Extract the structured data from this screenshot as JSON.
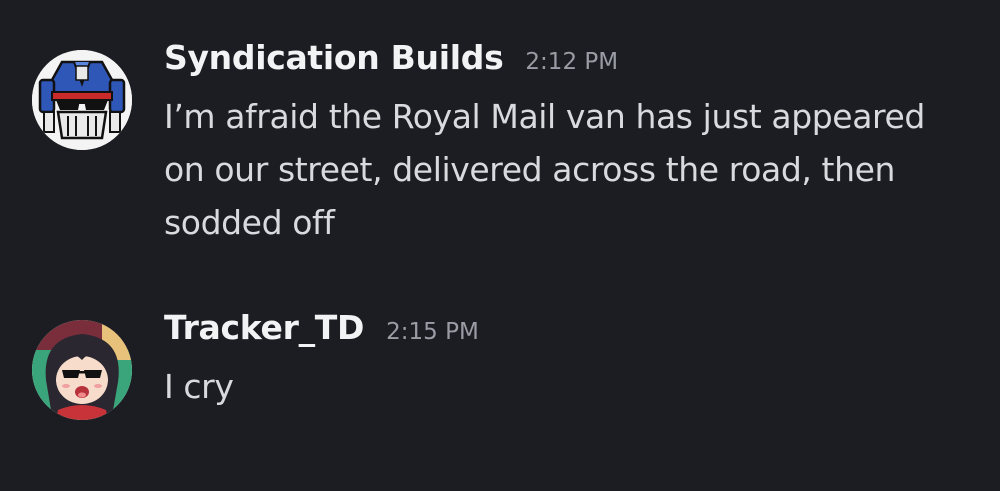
{
  "messages": [
    {
      "author": "Syndication Builds",
      "time": "2:12 PM",
      "text": "I’m afraid the Royal Mail van has just appeared on our street, delivered across the road, then sodded off",
      "avatar_icon": "robot-face-avatar"
    },
    {
      "author": "Tracker_TD",
      "time": "2:15 PM",
      "text": "I cry",
      "avatar_icon": "anime-character-avatar"
    }
  ],
  "colors": {
    "background": "#1c1d22",
    "username": "#f2f3f5",
    "timestamp": "#9a9ca5",
    "message_text": "#d9dade"
  }
}
